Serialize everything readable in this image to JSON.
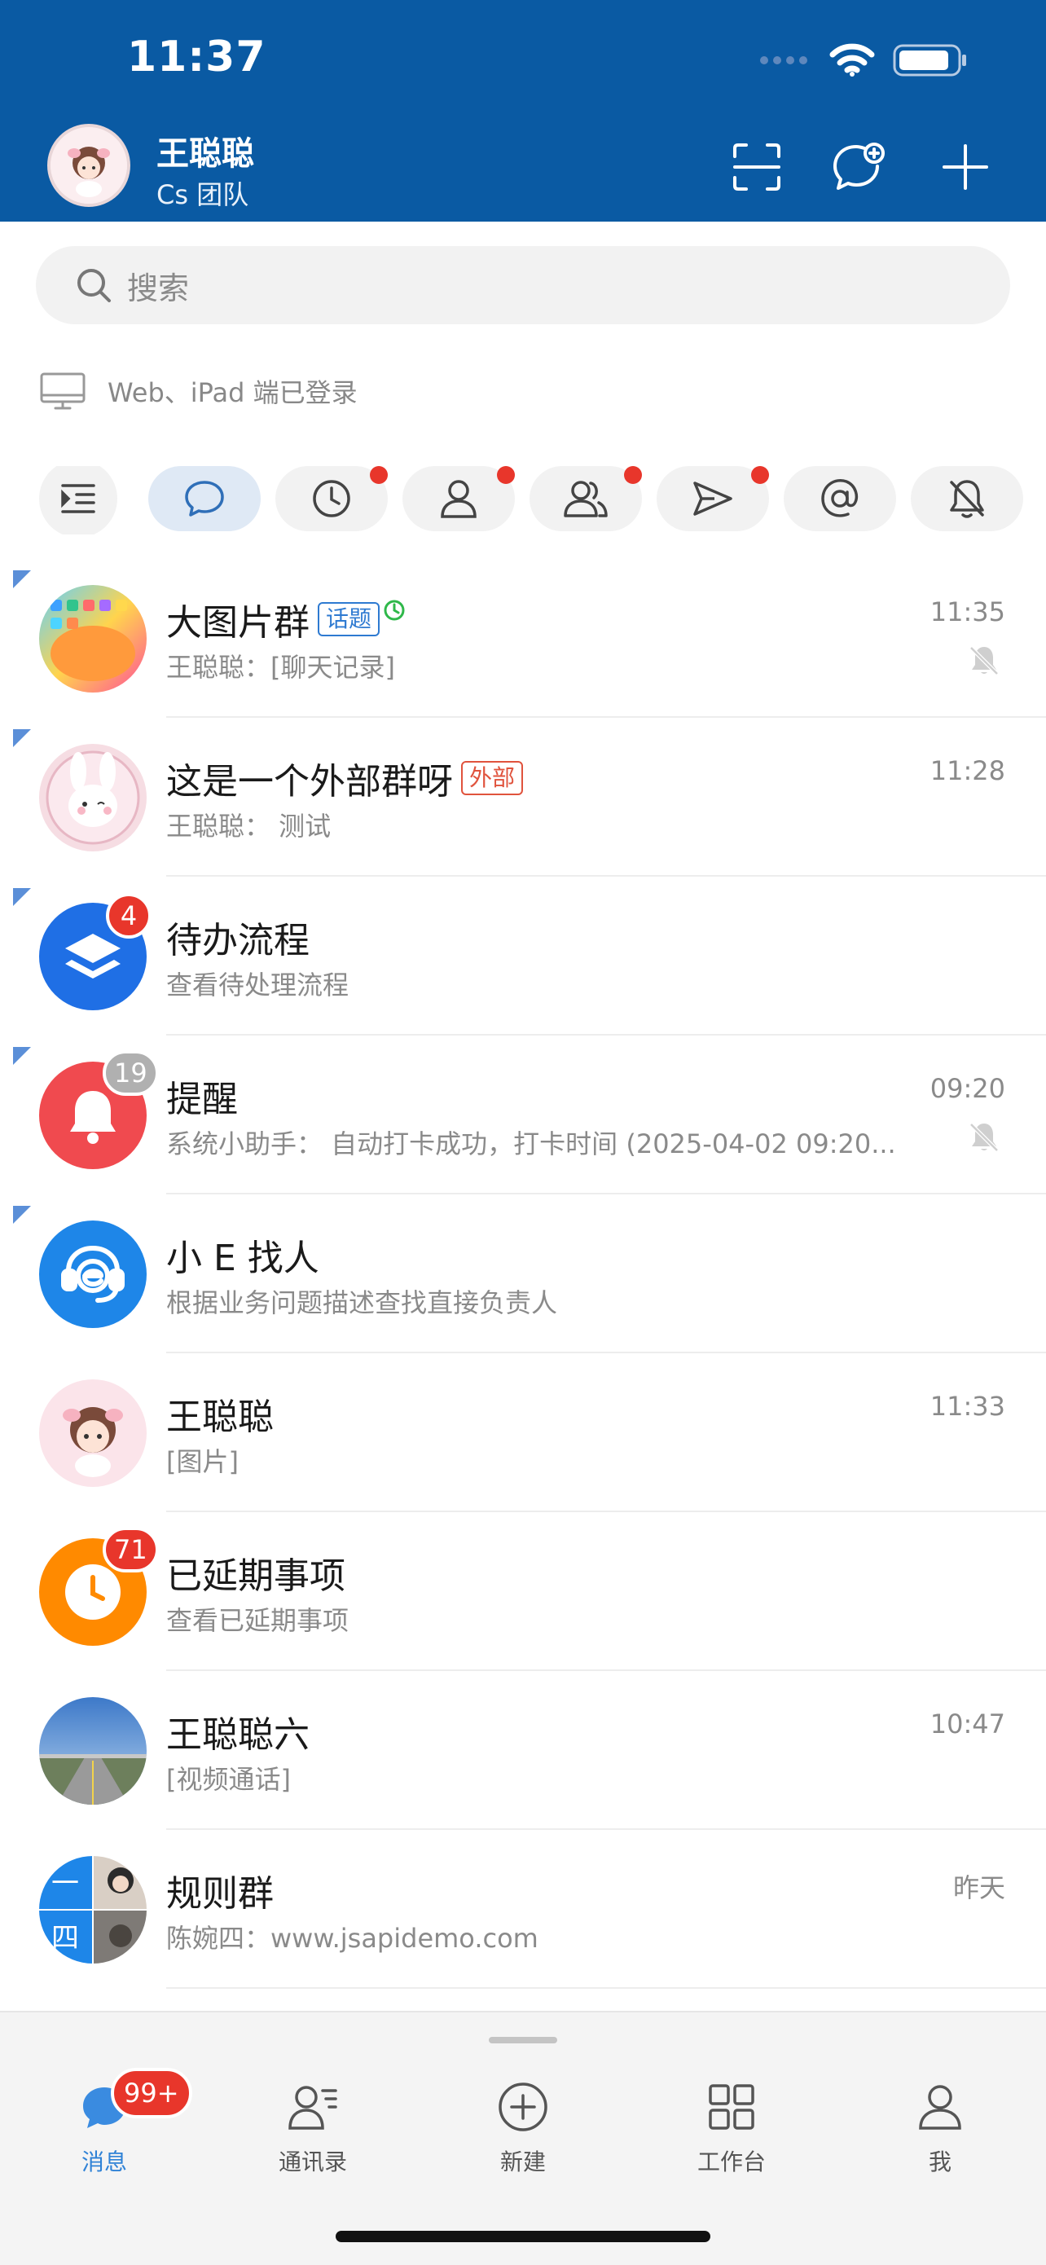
{
  "status_bar": {
    "time": "11:37"
  },
  "user": {
    "name": "王聪聪",
    "team": "Cs 团队"
  },
  "header_actions": [
    {
      "icon": "scan-icon"
    },
    {
      "icon": "new-chat-icon"
    },
    {
      "icon": "plus-icon"
    }
  ],
  "search": {
    "placeholder": "搜索"
  },
  "login_status": {
    "text": "Web、iPad 端已登录",
    "icon": "monitor-icon"
  },
  "filters": [
    {
      "icon": "menu-collapse-icon"
    },
    {
      "icon": "chat-bubble-icon",
      "active": true
    },
    {
      "icon": "clock-icon",
      "dot": true
    },
    {
      "icon": "person-icon",
      "dot": true
    },
    {
      "icon": "group-icon",
      "dot": true
    },
    {
      "icon": "send-icon",
      "dot": true
    },
    {
      "icon": "at-icon"
    },
    {
      "icon": "mute-bell-icon"
    }
  ],
  "conversations": [
    {
      "title": "大图片群",
      "tag": "话题",
      "tag_color": "blue",
      "subtitle": "王聪聪：[聊天记录]",
      "time": "11:35",
      "muted": true,
      "pinned": true,
      "avatar": "colorful-group-avatar"
    },
    {
      "title": "这是一个外部群呀",
      "tag": "外部",
      "tag_color": "red",
      "subtitle": "王聪聪： 测试",
      "time": "11:28",
      "muted": false,
      "pinned": true,
      "avatar": "bunny-avatar"
    },
    {
      "title": "待办流程",
      "subtitle": "查看待处理流程",
      "time": "",
      "badge": "4",
      "pinned": true,
      "avatar": "layers-avatar",
      "avatar_color": "#1f6fe5"
    },
    {
      "title": "提醒",
      "subtitle": "系统小助手： 自动打卡成功，打卡时间 (2025-04-02 09:20...",
      "time": "09:20",
      "badge": "19",
      "badge_grey": true,
      "muted": true,
      "pinned": true,
      "avatar": "bell-avatar",
      "avatar_color": "#f04a4f"
    },
    {
      "title": "小 E 找人",
      "subtitle": "根据业务问题描述查找直接负责人",
      "time": "",
      "pinned": true,
      "avatar": "support-avatar",
      "avatar_color": "#1e86e8"
    },
    {
      "title": "王聪聪",
      "subtitle": "[图片]",
      "time": "11:33",
      "avatar": "user-avatar"
    },
    {
      "title": "已延期事项",
      "subtitle": "查看已延期事项",
      "time": "",
      "badge": "71",
      "avatar": "clock-avatar",
      "avatar_color": "#ff8a00"
    },
    {
      "title": "王聪聪六",
      "subtitle": "[视频通话]",
      "time": "10:47",
      "avatar": "landscape-avatar"
    },
    {
      "title": "规则群",
      "subtitle": "陈婉四：www.jsapidemo.com",
      "time": "昨天",
      "avatar": "rule-group-avatar"
    }
  ],
  "rule_group_avatar_chars": [
    "一",
    "四"
  ],
  "tabbar": [
    {
      "label": "消息",
      "icon": "message-icon",
      "active": true,
      "badge": "99+"
    },
    {
      "label": "通讯录",
      "icon": "contacts-icon"
    },
    {
      "label": "新建",
      "icon": "add-circle-icon"
    },
    {
      "label": "工作台",
      "icon": "grid-icon"
    },
    {
      "label": "我",
      "icon": "profile-icon"
    }
  ],
  "colors": {
    "header": "#0a5aa3",
    "accent": "#2f82d6",
    "badge": "#e8362b"
  }
}
